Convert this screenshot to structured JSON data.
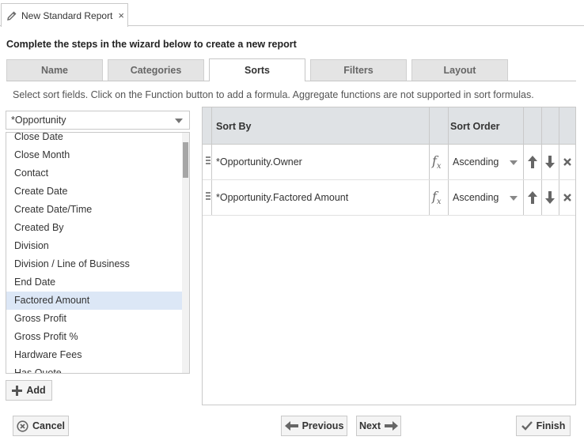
{
  "doc_tab": {
    "title": "New Standard Report",
    "close": "×",
    "edit_icon": "pencil-icon"
  },
  "instructions": "Complete the steps in the wizard below to create a new report",
  "wizard_tabs": [
    {
      "label": "Name",
      "active": false
    },
    {
      "label": "Categories",
      "active": false
    },
    {
      "label": "Sorts",
      "active": true
    },
    {
      "label": "Filters",
      "active": false
    },
    {
      "label": "Layout",
      "active": false
    }
  ],
  "hint": "Select sort fields. Click on the Function button to add a formula. Aggregate functions are not supported in sort formulas.",
  "entity_select": {
    "value": "*Opportunity"
  },
  "field_list": {
    "items": [
      "Close Date",
      "Close Month",
      "Contact",
      "Create Date",
      "Create Date/Time",
      "Created By",
      "Division",
      "Division / Line of Business",
      "End Date",
      "Factored Amount",
      "Gross Profit",
      "Gross Profit %",
      "Hardware Fees",
      "Has Quote"
    ],
    "selected": "Factored Amount"
  },
  "add_button": {
    "label": "Add",
    "icon": "plus-icon"
  },
  "sort_grid": {
    "headers": {
      "sort_by": "Sort By",
      "sort_order": "Sort Order"
    },
    "rows": [
      {
        "field": "*Opportunity.Owner",
        "order": "Ascending"
      },
      {
        "field": "*Opportunity.Factored Amount",
        "order": "Ascending"
      }
    ]
  },
  "buttons": {
    "cancel": "Cancel",
    "previous": "Previous",
    "next": "Next",
    "finish": "Finish"
  },
  "colors": {
    "selected_row": "#dce7f6",
    "header_bg": "#dfe2e5",
    "tab_inactive": "#e4e4e4"
  }
}
